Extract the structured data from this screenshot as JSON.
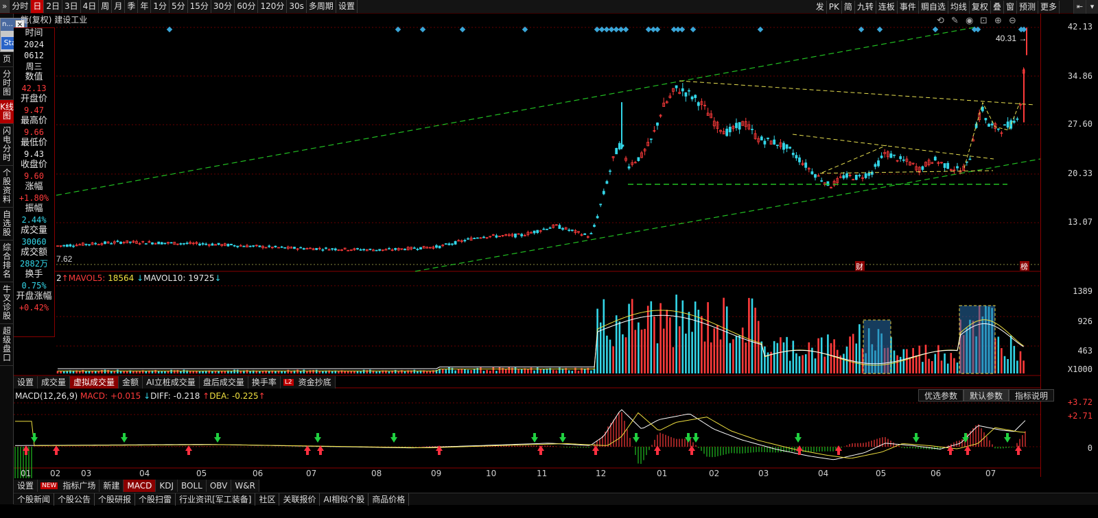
{
  "toolbar": {
    "period_tabs": [
      "分时",
      "日",
      "2日",
      "3日",
      "4日",
      "周",
      "月",
      "季",
      "年",
      "1分",
      "5分",
      "15分",
      "30分",
      "60分",
      "120分",
      "30s",
      "多周期",
      "设置"
    ],
    "active_period": "日",
    "right_buttons": [
      "发",
      "PK",
      "简",
      "九转",
      "连板",
      "事件",
      "赒自选",
      "均线",
      "复权",
      "叠",
      "窗",
      "预测",
      "更多"
    ]
  },
  "stock": {
    "mode": "(复权)",
    "name": "建设工业",
    "prefix": "能"
  },
  "popup": {
    "title_text": "n...",
    "start_label": "Start"
  },
  "left_nav": [
    "页",
    "分时图",
    "K线图",
    "闪电分时",
    "个股资料",
    "自选股",
    "综合排名",
    "牛叉诊股",
    "超级盘口"
  ],
  "left_nav_active": "K线图",
  "info": [
    {
      "label": "时间",
      "value": "2024"
    },
    {
      "label": "",
      "value": "0612"
    },
    {
      "label": "",
      "value": "周三"
    },
    {
      "label": "数值",
      "value": "42.13"
    },
    {
      "label": "开盘价",
      "value": "9.47"
    },
    {
      "label": "最高价",
      "value": "9.66"
    },
    {
      "label": "最低价",
      "value": "9.43"
    },
    {
      "label": "收盘价",
      "value": "9.60"
    },
    {
      "label": "涨幅",
      "value": "+1.80%"
    },
    {
      "label": "振幅",
      "value": "2.44%"
    },
    {
      "label": "成交量",
      "value": "30060"
    },
    {
      "label": "成交额",
      "value": "2882万"
    },
    {
      "label": "换手",
      "value": "0.75%"
    },
    {
      "label": "开盘涨幅",
      "value": "+0.42%"
    }
  ],
  "price_axis": [
    "42.13",
    "34.86",
    "27.60",
    "20.33",
    "13.07"
  ],
  "price_annotations": {
    "low_label": "7.62",
    "last_price": "40.31",
    "cai": "财",
    "bang": "榜"
  },
  "volume": {
    "header_prefix": "2",
    "mavol5_label": "MAVOL5:",
    "mavol5": "18564",
    "mavol10_label": "MAVOL10:",
    "mavol10": "19725",
    "axis": [
      "1389",
      "926",
      "463"
    ],
    "unit": "X1000"
  },
  "volume_tabs": [
    "设置",
    "成交量",
    "虚拟成交量",
    "金额",
    "AI立桩成交量",
    "盘后成交量",
    "换手率",
    "资金抄底"
  ],
  "volume_tab_active": "虚拟成交量",
  "l2_badge": "L2",
  "macd": {
    "name": "MACD(12,26,9)",
    "macd_label": "MACD:",
    "macd": "+0.015",
    "diff_label": "DIFF:",
    "diff": "-0.218",
    "dea_label": "DEA:",
    "dea": "-0.225",
    "axis": [
      "+3.72",
      "+2.71",
      "0"
    ],
    "buttons": [
      "优选参数",
      "默认参数",
      "指标说明"
    ],
    "button_active": "默认参数"
  },
  "dates": [
    "01",
    "02",
    "03",
    "04",
    "05",
    "06",
    "07",
    "08",
    "09",
    "10",
    "11",
    "12",
    "01",
    "02",
    "03",
    "04",
    "05",
    "06",
    "07"
  ],
  "bottom_tabs": [
    "设置",
    "指标广场",
    "新建",
    "MACD",
    "KDJ",
    "BOLL",
    "OBV",
    "W&R"
  ],
  "bottom_tab_active": "MACD",
  "new_badge": "NEW",
  "news_tabs": [
    "个股新闻",
    "个股公告",
    "个股研报",
    "个股扫雷",
    "行业资讯[军工装备]",
    "社区",
    "关联报价",
    "AI相似个股",
    "商品价格"
  ],
  "colors": {
    "up": "#ff3b3b",
    "down": "#33d6e8",
    "ma_white": "#ffffff",
    "ma_yellow": "#f0e040",
    "trend_green": "#22c022",
    "trend_yellow": "#e8e050",
    "grid_red": "#6a0000"
  }
}
